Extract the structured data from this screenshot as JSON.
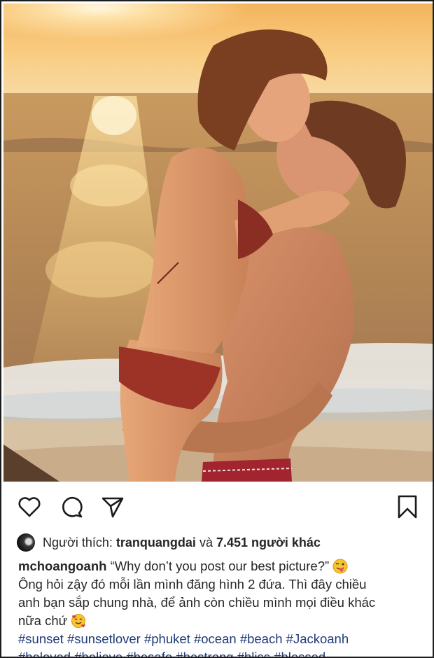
{
  "post": {
    "image_alt": "Couple embracing on the beach at sunset",
    "actions": {
      "like_icon": "heart-outline-icon",
      "comment_icon": "comment-bubble-icon",
      "share_icon": "paper-plane-icon",
      "save_icon": "bookmark-icon"
    },
    "likes": {
      "prefix": "Người thích:",
      "user": "tranquangdai",
      "conjunction": "và",
      "others": "7.451 người khác"
    },
    "caption": {
      "username": "mchoangoanh",
      "quote": "“Why don’t you post our best picture?”",
      "emoji_1": "winking-face-with-tongue",
      "line_2": "Ông hỏi zậy đó mỗi lần mình đăng hình 2 đứa. Thì đây chiều",
      "line_3": "anh bạn sắp chung nhà, để ảnh còn chiều mình mọi điều khác",
      "line_4": "nữa chứ",
      "emoji_2": "smiling-face-with-hearts"
    },
    "hashtags_line_1": [
      "#sunset",
      "#sunsetlover",
      "#phuket",
      "#ocean",
      "#beach",
      "#Jackoanh"
    ],
    "hashtags_line_2": [
      "#beloved",
      "#believe",
      "#besafe",
      "#bestrong",
      "#bliss",
      "#blessed"
    ]
  }
}
